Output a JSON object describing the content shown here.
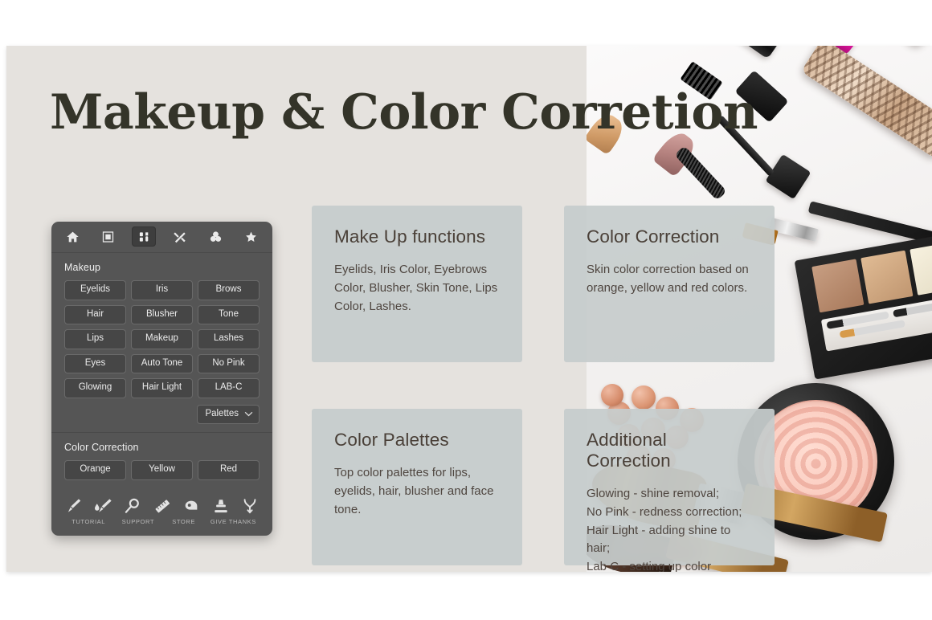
{
  "slide": {
    "title": "Makeup & Color Corretion",
    "background_color": "#e5e2de",
    "card_color": "#c6cccc",
    "panel_color": "#555555",
    "title_color": "#343429"
  },
  "panel": {
    "top_icons": [
      {
        "name": "home-icon",
        "label": "Home",
        "active": false
      },
      {
        "name": "frame-icon",
        "label": "Frame",
        "active": false
      },
      {
        "name": "makeup-tools-icon",
        "label": "Makeup",
        "active": true
      },
      {
        "name": "tools-icon",
        "label": "Tools",
        "active": false
      },
      {
        "name": "color-circles-icon",
        "label": "Colors",
        "active": false
      },
      {
        "name": "star-icon",
        "label": "Favorites",
        "active": false
      }
    ],
    "makeup": {
      "section_label": "Makeup",
      "buttons": [
        "Eyelids",
        "Iris",
        "Brows",
        "Hair",
        "Blusher",
        "Tone",
        "Lips",
        "Makeup",
        "Lashes",
        "Eyes",
        "Auto Tone",
        "No Pink",
        "Glowing",
        "Hair Light",
        "LAB-C"
      ],
      "dropdown": "Palettes"
    },
    "color_correction": {
      "section_label": "Color Correction",
      "buttons": [
        "Orange",
        "Yellow",
        "Red"
      ]
    },
    "tools": [
      {
        "name": "brush-icon"
      },
      {
        "name": "wet-brush-icon"
      },
      {
        "name": "magnifier-icon"
      },
      {
        "name": "ruler-icon"
      },
      {
        "name": "lasso-icon"
      },
      {
        "name": "stamp-icon"
      },
      {
        "name": "wishbone-icon"
      }
    ],
    "links": [
      "TUTORIAL",
      "SUPPORT",
      "STORE",
      "GIVE THANKS"
    ]
  },
  "cards": {
    "makeup": {
      "title": "Make Up functions",
      "body": "Eyelids, Iris Color, Eyebrows Color, Blusher, Skin Tone, Lips Color, Lashes."
    },
    "color_correction": {
      "title": "Color Correction",
      "body": "Skin color correction based on orange, yellow and red colors."
    },
    "palettes": {
      "title": "Color Palettes",
      "body": "Top color palettes for lips, eyelids, hair, blusher and face tone."
    },
    "additional": {
      "title": "Additional Correction",
      "body": "Glowing - shine removal;\nNo Pink - redness correction;\nHair Light - adding shine to hair;\nLab C - setting up color correction."
    }
  }
}
